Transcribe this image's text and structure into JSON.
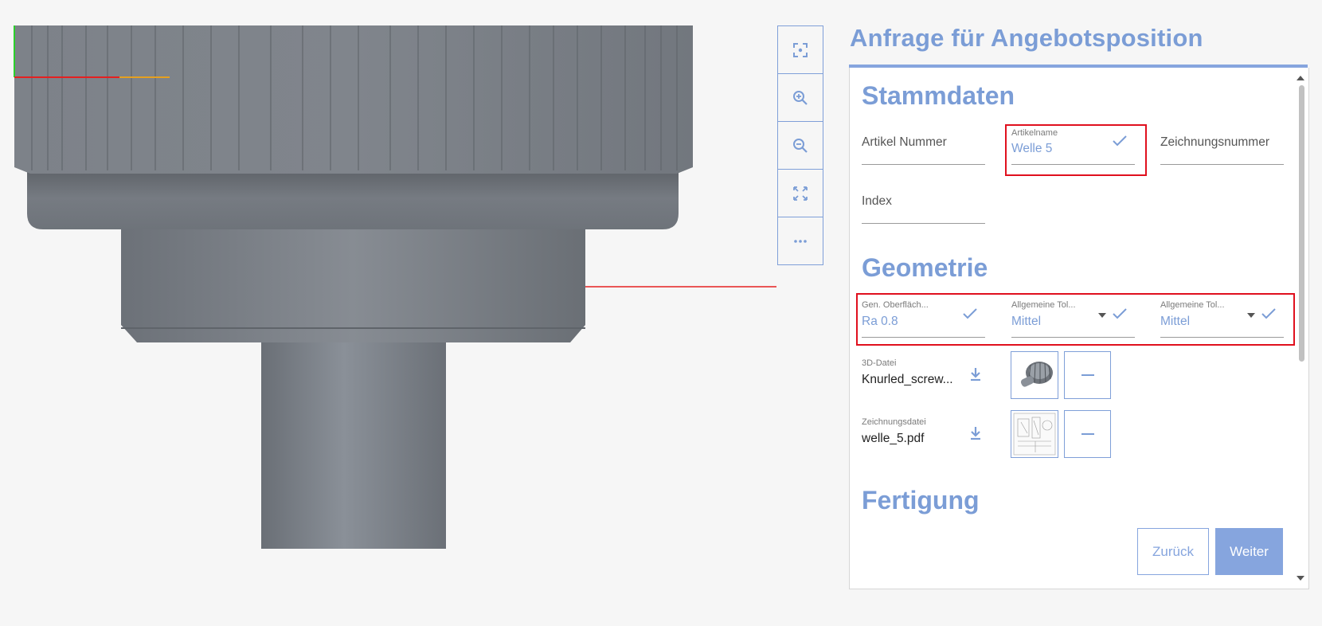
{
  "panel": {
    "title": "Anfrage für Angebotsposition"
  },
  "toolbar": {
    "buttons": [
      {
        "icon": "focus-center-icon"
      },
      {
        "icon": "zoom-in-icon"
      },
      {
        "icon": "zoom-out-icon"
      },
      {
        "icon": "fit-view-icon"
      },
      {
        "icon": "more-options-icon"
      }
    ]
  },
  "stammdaten": {
    "title": "Stammdaten",
    "artikel_nummer": {
      "placeholder": "Artikel Nummer"
    },
    "artikelname": {
      "label": "Artikelname",
      "value": "Welle 5"
    },
    "zeichnungsnummer": {
      "placeholder": "Zeichnungsnummer"
    },
    "index": {
      "placeholder": "Index"
    }
  },
  "geometrie": {
    "title": "Geometrie",
    "oberflaeche": {
      "label": "Gen. Oberfläch...",
      "value": "Ra 0.8"
    },
    "toleranz_1": {
      "label": "Allgemeine Tol...",
      "value": "Mittel"
    },
    "toleranz_2": {
      "label": "Allgemeine Tol...",
      "value": "Mittel"
    },
    "datei_3d": {
      "label": "3D-Datei",
      "value": "Knurled_screw..."
    },
    "zeichnungsdatei": {
      "label": "Zeichnungsdatei",
      "value": "welle_5.pdf"
    }
  },
  "fertigung": {
    "title": "Fertigung"
  },
  "navigation": {
    "back_label": "Zurück",
    "next_label": "Weiter"
  },
  "colors": {
    "accent": "#7b9dd6",
    "highlight": "#e0101e",
    "model": "#7a7f86",
    "background": "#f6f6f6"
  }
}
